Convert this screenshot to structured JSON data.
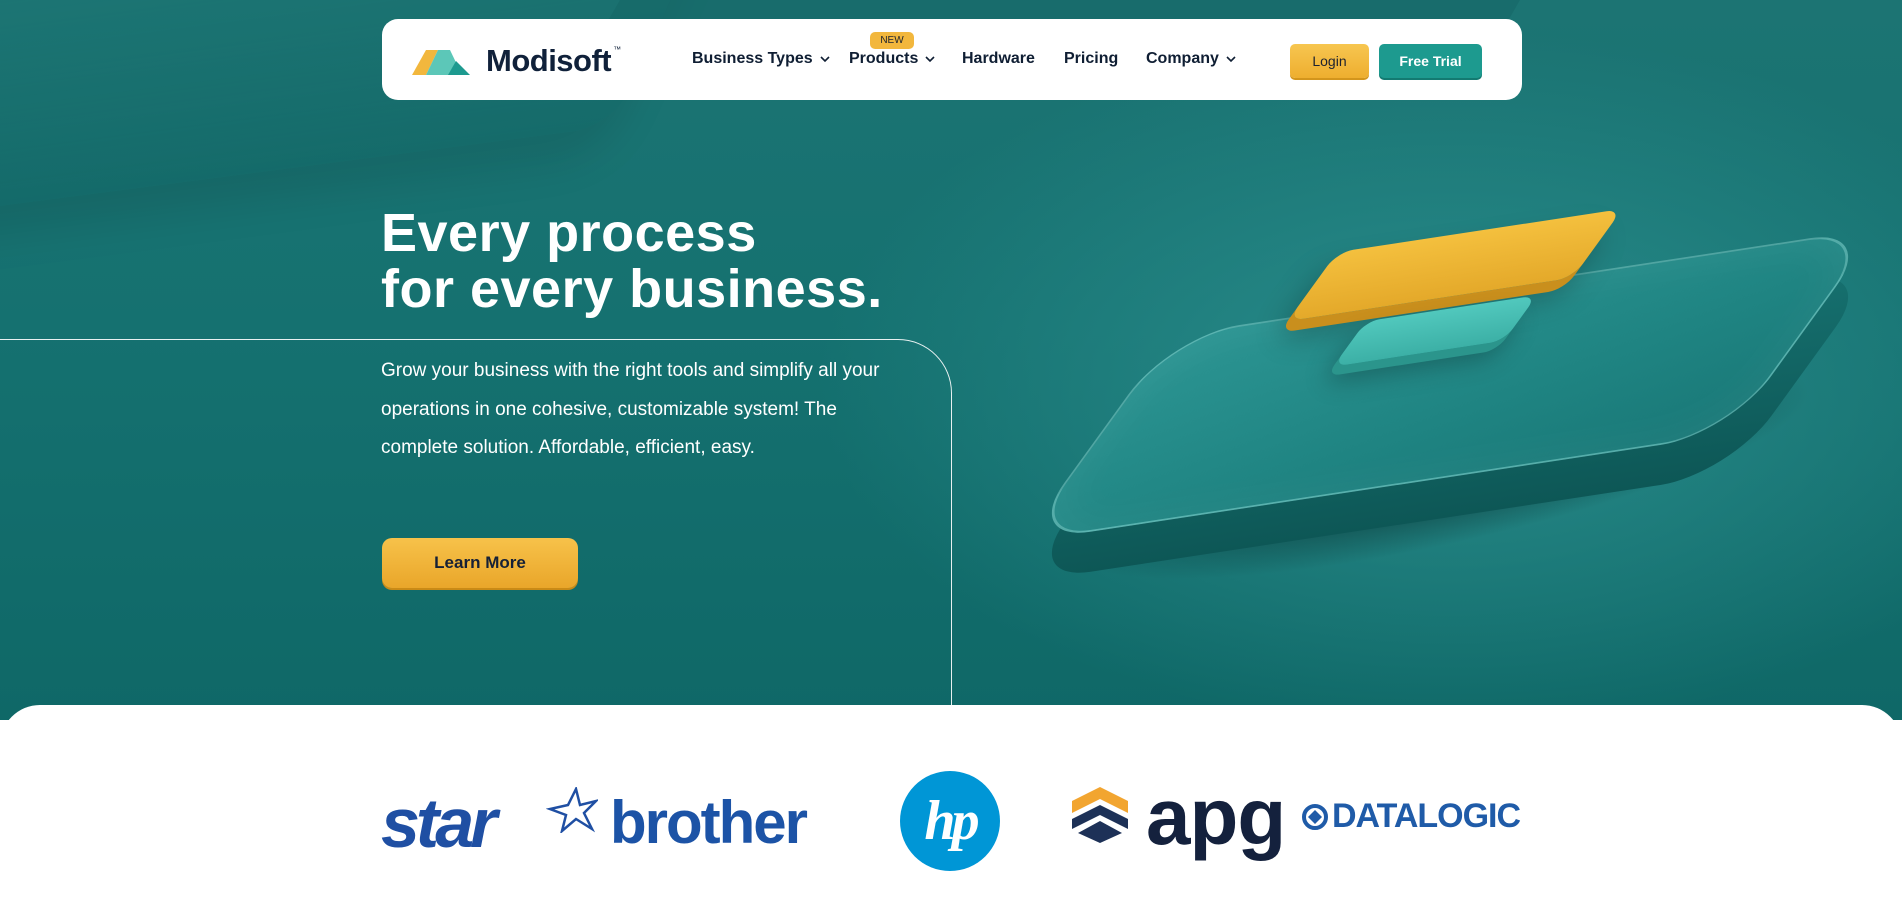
{
  "nav": {
    "brand": "Modisoft",
    "brand_tm": "™",
    "items": [
      {
        "label": "Business Types",
        "has_dropdown": true
      },
      {
        "label": "Products",
        "has_dropdown": true,
        "badge": "NEW"
      },
      {
        "label": "Hardware",
        "has_dropdown": false
      },
      {
        "label": "Pricing",
        "has_dropdown": false
      },
      {
        "label": "Company",
        "has_dropdown": true
      }
    ],
    "login_label": "Login",
    "trial_label": "Free Trial"
  },
  "hero": {
    "headline_line1": "Every process",
    "headline_line2": "for every business.",
    "subtext": "Grow your business with the right tools and simplify all your operations in one cohesive, customizable system! The complete solution. Affordable, efficient, easy.",
    "cta_label": "Learn More"
  },
  "partners": {
    "star": "star",
    "brother": "brother",
    "hp": "hp",
    "apg": "apg",
    "datalogic": "DATALOGIC"
  },
  "colors": {
    "hero_bg": "#157170",
    "accent_yellow": "#f2b73d",
    "accent_teal": "#1d9a8f",
    "text_dark": "#0f1e33"
  }
}
